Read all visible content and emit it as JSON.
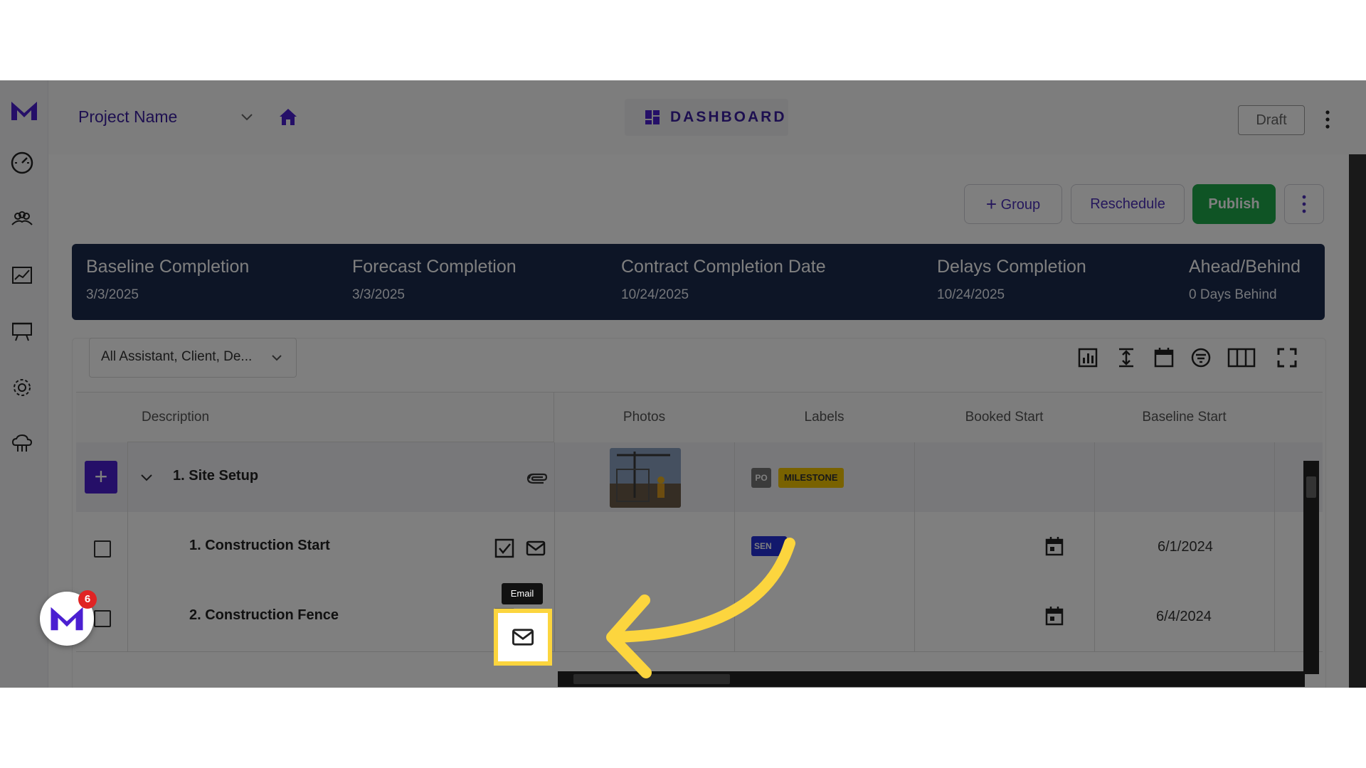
{
  "header": {
    "project_name": "Project Name",
    "dashboard_label": "DASHBOARD",
    "draft_label": "Draft"
  },
  "toolbar": {
    "group_label": "Group",
    "reschedule_label": "Reschedule",
    "publish_label": "Publish"
  },
  "summary": [
    {
      "title": "Baseline Completion",
      "value": "3/3/2025"
    },
    {
      "title": "Forecast Completion",
      "value": "3/3/2025"
    },
    {
      "title": "Contract Completion Date",
      "value": "10/24/2025"
    },
    {
      "title": "Delays Completion",
      "value": "10/24/2025"
    },
    {
      "title": "Ahead/Behind",
      "value": "0 Days Behind"
    }
  ],
  "filter": {
    "value": "All Assistant, Client, De..."
  },
  "columns": [
    "Description",
    "Photos",
    "Labels",
    "Booked Start",
    "Baseline Start"
  ],
  "rows": [
    {
      "title": "1. Site Setup",
      "labels": [
        "PO",
        "MILESTONE"
      ]
    },
    {
      "title": "1. Construction Start",
      "label": "SEN",
      "baseline_start": "6/1/2024"
    },
    {
      "title": "2. Construction Fence",
      "baseline_start": "6/4/2024"
    }
  ],
  "tooltip": "Email",
  "notifications": {
    "count": "6"
  },
  "colors": {
    "accent": "#4b1fd1",
    "brand_text": "#3b1fa1",
    "publish": "#1fa84a",
    "summary_bg": "#1b2a4c",
    "highlight": "#fcd53e",
    "milestone": "#f3c400"
  }
}
